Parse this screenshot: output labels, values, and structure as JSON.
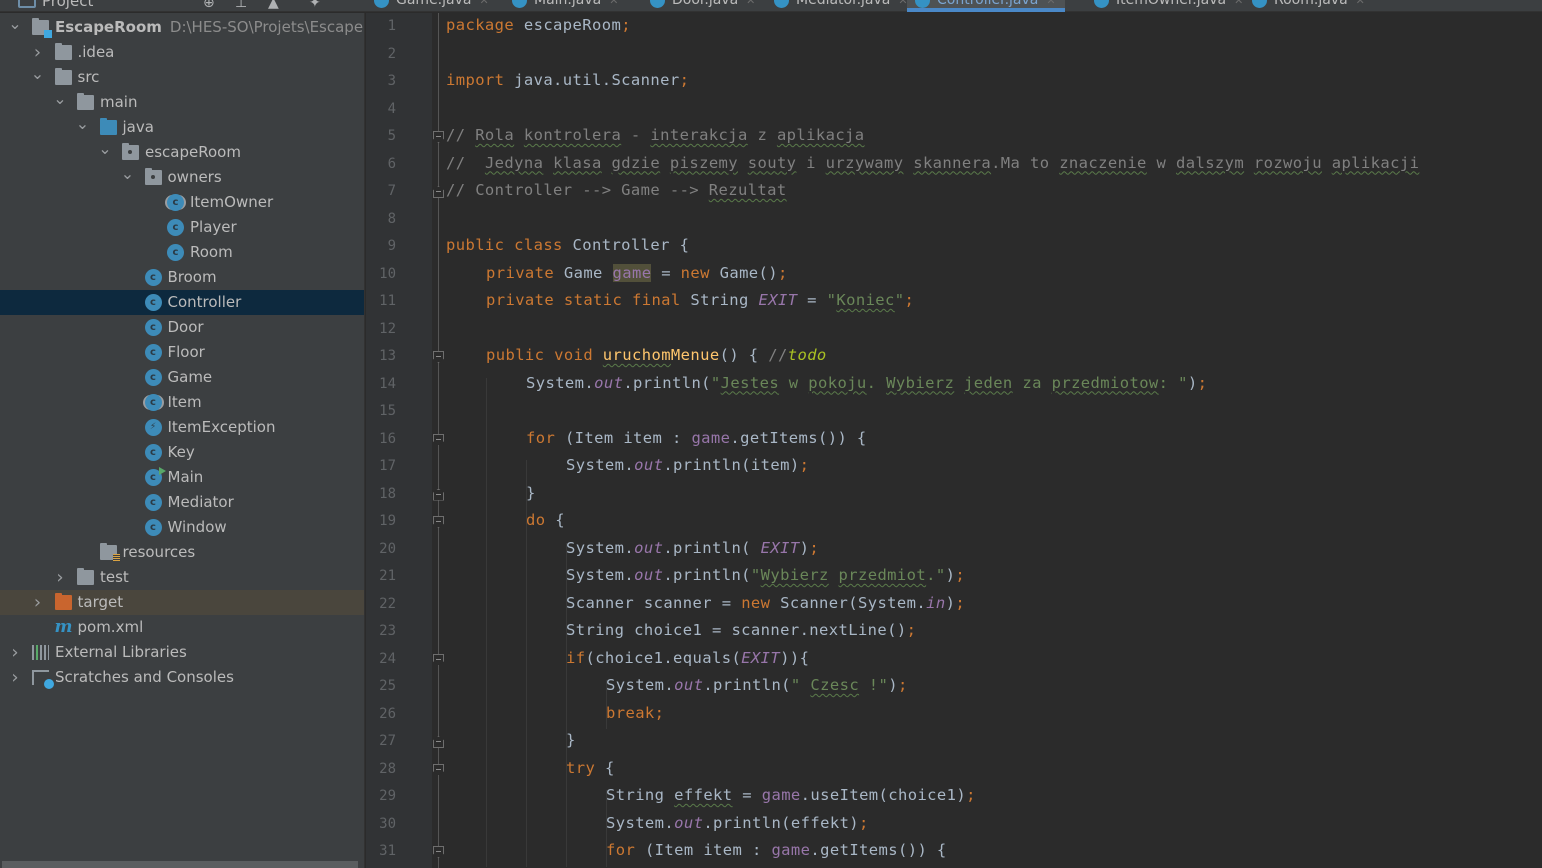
{
  "project_panel": {
    "title": "Project",
    "toolbar_icons": [
      "globe-target-icon",
      "collapse-all-icon",
      "expand-icon",
      "gear-icon"
    ]
  },
  "tabs": [
    {
      "label": "Game.java",
      "active": false
    },
    {
      "label": "Main.java",
      "active": false
    },
    {
      "label": "Door.java",
      "active": false
    },
    {
      "label": "Mediator.java",
      "active": false
    },
    {
      "label": "Controller.java",
      "active": true
    },
    {
      "label": "ItemOwner.java",
      "active": false
    },
    {
      "label": "Room.java",
      "active": false
    }
  ],
  "tree": [
    {
      "label": "EscapeRoom",
      "path": "D:\\HES-SO\\Projets\\EscapeRoom",
      "icon": "module-folder-icon",
      "chevron": "down",
      "depth": 0
    },
    {
      "label": ".idea",
      "icon": "folder-icon",
      "chevron": "right",
      "depth": 1
    },
    {
      "label": "src",
      "icon": "folder-icon",
      "chevron": "down",
      "depth": 1
    },
    {
      "label": "main",
      "icon": "folder-icon",
      "chevron": "down",
      "depth": 2
    },
    {
      "label": "java",
      "icon": "source-folder-icon",
      "chevron": "down",
      "depth": 3
    },
    {
      "label": "escapeRoom",
      "icon": "package-icon",
      "chevron": "down",
      "depth": 4
    },
    {
      "label": "owners",
      "icon": "package-icon",
      "chevron": "down",
      "depth": 5
    },
    {
      "label": "ItemOwner",
      "icon": "abstract-class-icon",
      "depth": 6
    },
    {
      "label": "Player",
      "icon": "class-icon",
      "depth": 6
    },
    {
      "label": "Room",
      "icon": "class-icon",
      "depth": 6
    },
    {
      "label": "Broom",
      "icon": "class-icon",
      "depth": 5
    },
    {
      "label": "Controller",
      "icon": "class-icon",
      "depth": 5,
      "selected": true
    },
    {
      "label": "Door",
      "icon": "class-icon",
      "depth": 5
    },
    {
      "label": "Floor",
      "icon": "class-icon",
      "depth": 5
    },
    {
      "label": "Game",
      "icon": "class-icon",
      "depth": 5
    },
    {
      "label": "Item",
      "icon": "abstract-class-icon",
      "depth": 5
    },
    {
      "label": "ItemException",
      "icon": "exception-class-icon",
      "depth": 5
    },
    {
      "label": "Key",
      "icon": "class-icon",
      "depth": 5
    },
    {
      "label": "Main",
      "icon": "runnable-class-icon",
      "depth": 5
    },
    {
      "label": "Mediator",
      "icon": "class-icon",
      "depth": 5
    },
    {
      "label": "Window",
      "icon": "class-icon",
      "depth": 5
    },
    {
      "label": "resources",
      "icon": "resources-folder-icon",
      "depth": 3
    },
    {
      "label": "test",
      "icon": "folder-icon",
      "chevron": "right",
      "depth": 2
    },
    {
      "label": "target",
      "icon": "excluded-folder-icon",
      "chevron": "right",
      "depth": 1,
      "excluded": true
    },
    {
      "label": "pom.xml",
      "icon": "maven-icon",
      "depth": 1
    },
    {
      "label": "External Libraries",
      "icon": "libraries-icon",
      "chevron": "right",
      "depth": 0
    },
    {
      "label": "Scratches and Consoles",
      "icon": "scratches-icon",
      "chevron": "right",
      "depth": 0
    }
  ],
  "editor": {
    "file": "Controller.java",
    "lines": [
      {
        "n": 1,
        "indent": 0,
        "tokens": [
          [
            "kw",
            "package "
          ],
          [
            "",
            "escapeRoom"
          ],
          [
            "kw",
            ";"
          ]
        ]
      },
      {
        "n": 2,
        "indent": 0,
        "tokens": []
      },
      {
        "n": 3,
        "indent": 0,
        "tokens": [
          [
            "kw",
            "import "
          ],
          [
            "",
            "java.util.Scanner"
          ],
          [
            "kw",
            ";"
          ]
        ]
      },
      {
        "n": 4,
        "indent": 0,
        "tokens": []
      },
      {
        "n": 5,
        "indent": 0,
        "fold": "start",
        "tokens": [
          [
            "cmt",
            "// "
          ],
          [
            "cmt typo",
            "Rola"
          ],
          [
            "cmt",
            " "
          ],
          [
            "cmt typo",
            "kontrolera"
          ],
          [
            "cmt",
            " - "
          ],
          [
            "cmt typo",
            "interakcja"
          ],
          [
            "cmt",
            " z "
          ],
          [
            "cmt typo",
            "aplikacja"
          ]
        ]
      },
      {
        "n": 6,
        "indent": 0,
        "tokens": [
          [
            "cmt",
            "//  "
          ],
          [
            "cmt typo",
            "Jedyna"
          ],
          [
            "cmt",
            " "
          ],
          [
            "cmt typo",
            "klasa"
          ],
          [
            "cmt",
            " "
          ],
          [
            "cmt typo",
            "gdzie"
          ],
          [
            "cmt",
            " "
          ],
          [
            "cmt typo",
            "piszemy"
          ],
          [
            "cmt",
            " "
          ],
          [
            "cmt typo",
            "souty"
          ],
          [
            "cmt",
            " i "
          ],
          [
            "cmt typo",
            "urzywamy"
          ],
          [
            "cmt",
            " "
          ],
          [
            "cmt typo",
            "skannera"
          ],
          [
            "cmt",
            ".Ma to "
          ],
          [
            "cmt typo",
            "znaczenie"
          ],
          [
            "cmt",
            " w "
          ],
          [
            "cmt typo",
            "dalszym"
          ],
          [
            "cmt",
            " "
          ],
          [
            "cmt typo",
            "rozwoju"
          ],
          [
            "cmt",
            " "
          ],
          [
            "cmt typo",
            "aplikacji"
          ]
        ]
      },
      {
        "n": 7,
        "indent": 0,
        "fold": "end",
        "tokens": [
          [
            "cmt",
            "// Controller --> Game --> "
          ],
          [
            "cmt typo",
            "Rezultat"
          ]
        ]
      },
      {
        "n": 8,
        "indent": 0,
        "tokens": []
      },
      {
        "n": 9,
        "indent": 0,
        "tokens": [
          [
            "kw",
            "public class "
          ],
          [
            "",
            "Controller {"
          ]
        ]
      },
      {
        "n": 10,
        "indent": 1,
        "tokens": [
          [
            "kw",
            "private "
          ],
          [
            "",
            "Game "
          ],
          [
            "fld hl",
            "game"
          ],
          [
            "",
            " = "
          ],
          [
            "kw",
            "new "
          ],
          [
            "",
            "Game()"
          ],
          [
            "kw",
            ";"
          ]
        ]
      },
      {
        "n": 11,
        "indent": 1,
        "tokens": [
          [
            "kw",
            "private static final "
          ],
          [
            "",
            "String "
          ],
          [
            "sfld",
            "EXIT"
          ],
          [
            "",
            " = "
          ],
          [
            "str",
            "\""
          ],
          [
            "str typo",
            "Koniec"
          ],
          [
            "str",
            "\""
          ],
          [
            "kw",
            ";"
          ]
        ]
      },
      {
        "n": 12,
        "indent": 0,
        "tokens": []
      },
      {
        "n": 13,
        "indent": 1,
        "fold": "start",
        "tokens": [
          [
            "kw",
            "public void "
          ],
          [
            "meth typo",
            "uruchom"
          ],
          [
            "meth",
            "Menue"
          ],
          [
            "",
            "() { "
          ],
          [
            "cmt",
            "//"
          ],
          [
            "todo",
            "todo"
          ]
        ]
      },
      {
        "n": 14,
        "indent": 2,
        "tokens": [
          [
            "",
            "System."
          ],
          [
            "sfld",
            "out"
          ],
          [
            "",
            ".println("
          ],
          [
            "str",
            "\""
          ],
          [
            "str typo",
            "Jestes"
          ],
          [
            "str",
            " w "
          ],
          [
            "str typo",
            "pokoju"
          ],
          [
            "str",
            ". "
          ],
          [
            "str typo",
            "Wybierz"
          ],
          [
            "str",
            " "
          ],
          [
            "str typo",
            "jeden"
          ],
          [
            "str",
            " za "
          ],
          [
            "str typo",
            "przedmiotow"
          ],
          [
            "str",
            ": \""
          ],
          [
            "",
            ")"
          ],
          [
            "kw",
            ";"
          ]
        ]
      },
      {
        "n": 15,
        "indent": 0,
        "tokens": []
      },
      {
        "n": 16,
        "indent": 2,
        "fold": "start",
        "tokens": [
          [
            "kw",
            "for "
          ],
          [
            "",
            "(Item item : "
          ],
          [
            "fld",
            "game"
          ],
          [
            "",
            ".getItems()) {"
          ]
        ]
      },
      {
        "n": 17,
        "indent": 3,
        "tokens": [
          [
            "",
            "System."
          ],
          [
            "sfld",
            "out"
          ],
          [
            "",
            ".println(item)"
          ],
          [
            "kw",
            ";"
          ]
        ]
      },
      {
        "n": 18,
        "indent": 2,
        "fold": "end",
        "tokens": [
          [
            "",
            "}"
          ]
        ]
      },
      {
        "n": 19,
        "indent": 2,
        "fold": "start",
        "tokens": [
          [
            "kw",
            "do "
          ],
          [
            "",
            "{"
          ]
        ]
      },
      {
        "n": 20,
        "indent": 3,
        "tokens": [
          [
            "",
            "System."
          ],
          [
            "sfld",
            "out"
          ],
          [
            "",
            ".println( "
          ],
          [
            "sfld",
            "EXIT"
          ],
          [
            "",
            ")"
          ],
          [
            "kw",
            ";"
          ]
        ]
      },
      {
        "n": 21,
        "indent": 3,
        "tokens": [
          [
            "",
            "System."
          ],
          [
            "sfld",
            "out"
          ],
          [
            "",
            ".println("
          ],
          [
            "str",
            "\""
          ],
          [
            "str typo",
            "Wybierz"
          ],
          [
            "str",
            " "
          ],
          [
            "str typo",
            "przedmiot"
          ],
          [
            "str",
            ".\""
          ],
          [
            "",
            ")"
          ],
          [
            "kw",
            ";"
          ]
        ]
      },
      {
        "n": 22,
        "indent": 3,
        "tokens": [
          [
            "",
            "Scanner scanner = "
          ],
          [
            "kw",
            "new "
          ],
          [
            "",
            "Scanner(System."
          ],
          [
            "sfld",
            "in"
          ],
          [
            "",
            ")"
          ],
          [
            "kw",
            ";"
          ]
        ]
      },
      {
        "n": 23,
        "indent": 3,
        "tokens": [
          [
            "",
            "String choice1 = scanner.nextLine()"
          ],
          [
            "kw",
            ";"
          ]
        ]
      },
      {
        "n": 24,
        "indent": 3,
        "fold": "start",
        "tokens": [
          [
            "kw",
            "if"
          ],
          [
            "",
            "(choice1.equals("
          ],
          [
            "sfld",
            "EXIT"
          ],
          [
            "",
            ")){"
          ]
        ]
      },
      {
        "n": 25,
        "indent": 4,
        "tokens": [
          [
            "",
            "System."
          ],
          [
            "sfld",
            "out"
          ],
          [
            "",
            ".println("
          ],
          [
            "str",
            "\" "
          ],
          [
            "str typo",
            "Czesc"
          ],
          [
            "str",
            " !\""
          ],
          [
            "",
            ")"
          ],
          [
            "kw",
            ";"
          ]
        ]
      },
      {
        "n": 26,
        "indent": 4,
        "tokens": [
          [
            "kw",
            "break;"
          ]
        ]
      },
      {
        "n": 27,
        "indent": 3,
        "fold": "end",
        "tokens": [
          [
            "",
            "}"
          ]
        ]
      },
      {
        "n": 28,
        "indent": 3,
        "fold": "start",
        "tokens": [
          [
            "kw",
            "try "
          ],
          [
            "",
            "{"
          ]
        ]
      },
      {
        "n": 29,
        "indent": 4,
        "tokens": [
          [
            "",
            "String "
          ],
          [
            "typo",
            "effekt"
          ],
          [
            "",
            " = "
          ],
          [
            "fld",
            "game"
          ],
          [
            "",
            ".useItem(choice1)"
          ],
          [
            "kw",
            ";"
          ]
        ]
      },
      {
        "n": 30,
        "indent": 4,
        "tokens": [
          [
            "",
            "System."
          ],
          [
            "sfld",
            "out"
          ],
          [
            "",
            ".println(effekt)"
          ],
          [
            "kw",
            ";"
          ]
        ]
      },
      {
        "n": 31,
        "indent": 4,
        "fold": "start",
        "tokens": [
          [
            "kw",
            "for "
          ],
          [
            "",
            "(Item item : "
          ],
          [
            "fld",
            "game"
          ],
          [
            "",
            ".getItems()) {"
          ]
        ]
      }
    ]
  }
}
